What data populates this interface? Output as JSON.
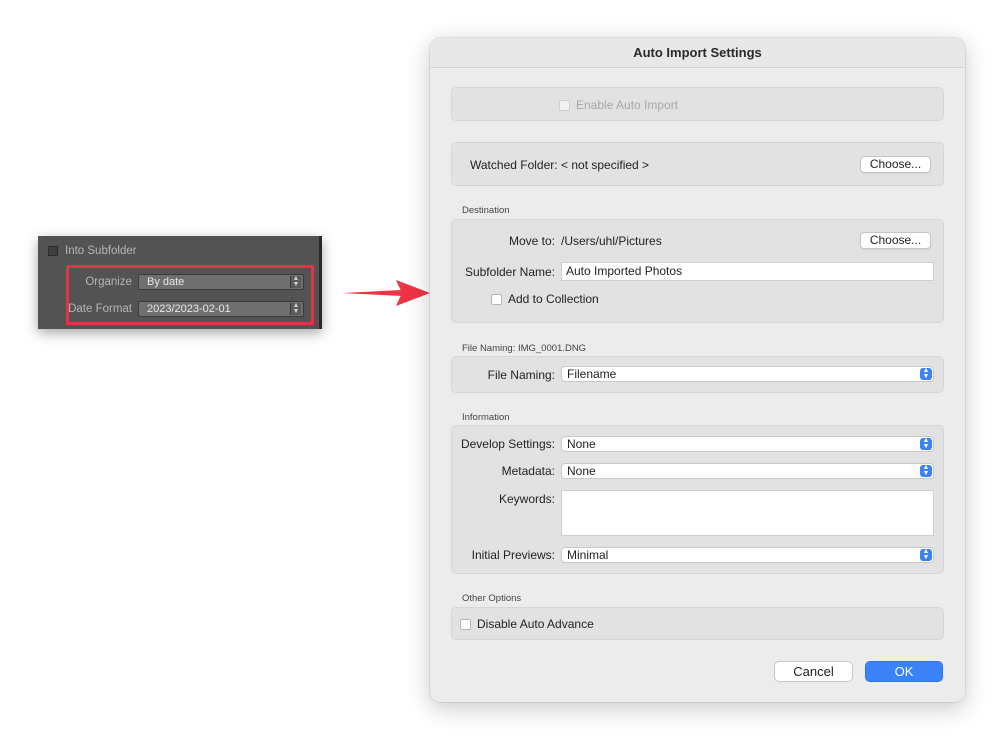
{
  "inset": {
    "into_subfolder_label": "Into Subfolder",
    "organize_label": "Organize",
    "organize_value": "By date",
    "date_format_label": "Date Format",
    "date_format_value": "2023/2023-02-01",
    "highlight_color": "#e03548"
  },
  "arrow": {
    "color": "#ee3344",
    "icon": "arrow-right-icon"
  },
  "dialog": {
    "title": "Auto Import Settings",
    "enable_auto_import_label": "Enable Auto Import",
    "watched_folder_label": "Watched Folder:",
    "watched_folder_value": "< not specified >",
    "choose_label": "Choose...",
    "destination": {
      "section_label": "Destination",
      "move_to_label": "Move to:",
      "move_to_value": "/Users/uhl/Pictures",
      "choose_label": "Choose...",
      "subfolder_name_label": "Subfolder Name:",
      "subfolder_name_value": "Auto Imported Photos",
      "add_to_collection_label": "Add to Collection"
    },
    "file_naming": {
      "section_label": "File Naming:  IMG_0001.DNG",
      "label": "File Naming:",
      "value": "Filename"
    },
    "information": {
      "section_label": "Information",
      "develop_settings_label": "Develop Settings:",
      "develop_settings_value": "None",
      "metadata_label": "Metadata:",
      "metadata_value": "None",
      "keywords_label": "Keywords:",
      "keywords_value": "",
      "initial_previews_label": "Initial Previews:",
      "initial_previews_value": "Minimal"
    },
    "other_options": {
      "section_label": "Other Options",
      "disable_auto_advance_label": "Disable Auto Advance"
    },
    "cancel_label": "Cancel",
    "ok_label": "OK",
    "accent_color": "#3b82f6"
  }
}
